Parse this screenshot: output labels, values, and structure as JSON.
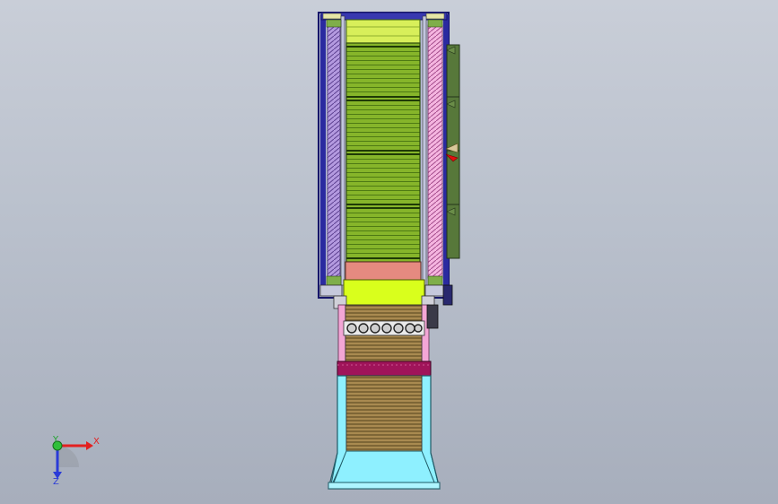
{
  "viewport": {
    "background_top": "#c9ced8",
    "background_bottom": "#a7aebc"
  },
  "colors": {
    "frame_blue": "#2a2aa0",
    "frame_navy": "#16166a",
    "screw_purple": "#a98ad6",
    "screw_pink": "#f2a7d8",
    "mesh_green": "#86b52a",
    "mesh_dark": "#3d6010",
    "salmon": "#e58a80",
    "lime": "#d9ff1c",
    "cyan": "#8ef0ff",
    "magenta": "#a0145a",
    "olive": "#57783a",
    "red_marker": "#e01010"
  },
  "axes": {
    "x_label": "X",
    "y_label": "Y",
    "z_label": "Z",
    "x_color": "#e32020",
    "y_color": "#1fa32e",
    "z_color": "#2a3bd8"
  }
}
